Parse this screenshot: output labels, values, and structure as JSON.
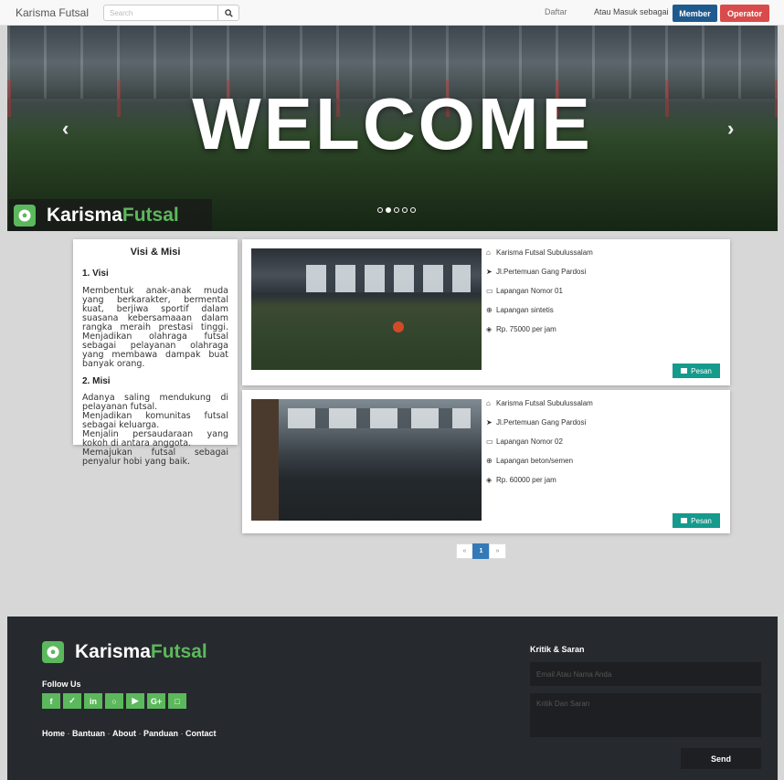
{
  "navbar": {
    "brand": "Karisma Futsal",
    "search_placeholder": "Search",
    "daftar": "Daftar",
    "atau_masuk": "Atau Masuk sebagai",
    "member": "Member",
    "operator": "Operator"
  },
  "carousel": {
    "headline": "WELCOME",
    "logo_part1": "Karisma",
    "logo_part2": "Futsal",
    "slides": 5,
    "active_slide": 2
  },
  "visi_misi": {
    "title": "Visi & Misi",
    "visi_heading": "1. Visi",
    "visi_text": "Membentuk anak-anak muda yang berkarakter, bermental kuat, berjiwa sportif dalam suasana kebersamaaan dalam rangka meraih prestasi tinggi. Menjadikan olahraga futsal sebagai pelayanan olahraga yang membawa dampak buat banyak orang.",
    "misi_heading": "2. Misi",
    "misi_lines": [
      "Adanya saling mendukung di pelayanan futsal.",
      "Menjadikan komunitas futsal sebagai keluarga.",
      "Menjalin persaudaraan yang kokoh di antara anggota.",
      "Memajukan futsal sebagai penyalur hobi yang baik."
    ]
  },
  "fields": [
    {
      "name": "Karisma Futsal Subulussalam",
      "address": "Jl.Pertemuan Gang Pardosi",
      "number": "Lapangan Nomor 01",
      "type": "Lapangan sintetis",
      "price": "Rp. 75000 per jam",
      "button": "Pesan"
    },
    {
      "name": "Karisma Futsal Subulussalam",
      "address": "Jl.Pertemuan Gang Pardosi",
      "number": "Lapangan Nomor 02",
      "type": "Lapangan beton/semen",
      "price": "Rp. 60000 per jam",
      "button": "Pesan"
    }
  ],
  "pagination": {
    "prev": "«",
    "current": "1",
    "next": "»"
  },
  "footer": {
    "logo_part1": "Karisma",
    "logo_part2": "Futsal",
    "follow_us": "Follow Us",
    "social_icons": [
      "facebook-icon",
      "twitter-icon",
      "linkedin-icon",
      "github-icon",
      "youtube-icon",
      "google-plus-icon",
      "instagram-icon"
    ],
    "social_glyphs": [
      "f",
      "✓",
      "in",
      "○",
      "▶",
      "G+",
      "□"
    ],
    "links": [
      "Home",
      "Bantuan",
      "About",
      "Panduan",
      "Contact"
    ],
    "separator": " · ",
    "kritik_title": "Kritik & Saran",
    "email_placeholder": "Email Atau Nama Anda",
    "saran_placeholder": "Kritik Dan Saran",
    "send": "Send"
  },
  "colors": {
    "member": "#1f5a8f",
    "operator": "#d94b4b",
    "pesan": "#159a8c",
    "brand_green": "#5cb85c",
    "footer_bg": "#26292d"
  }
}
